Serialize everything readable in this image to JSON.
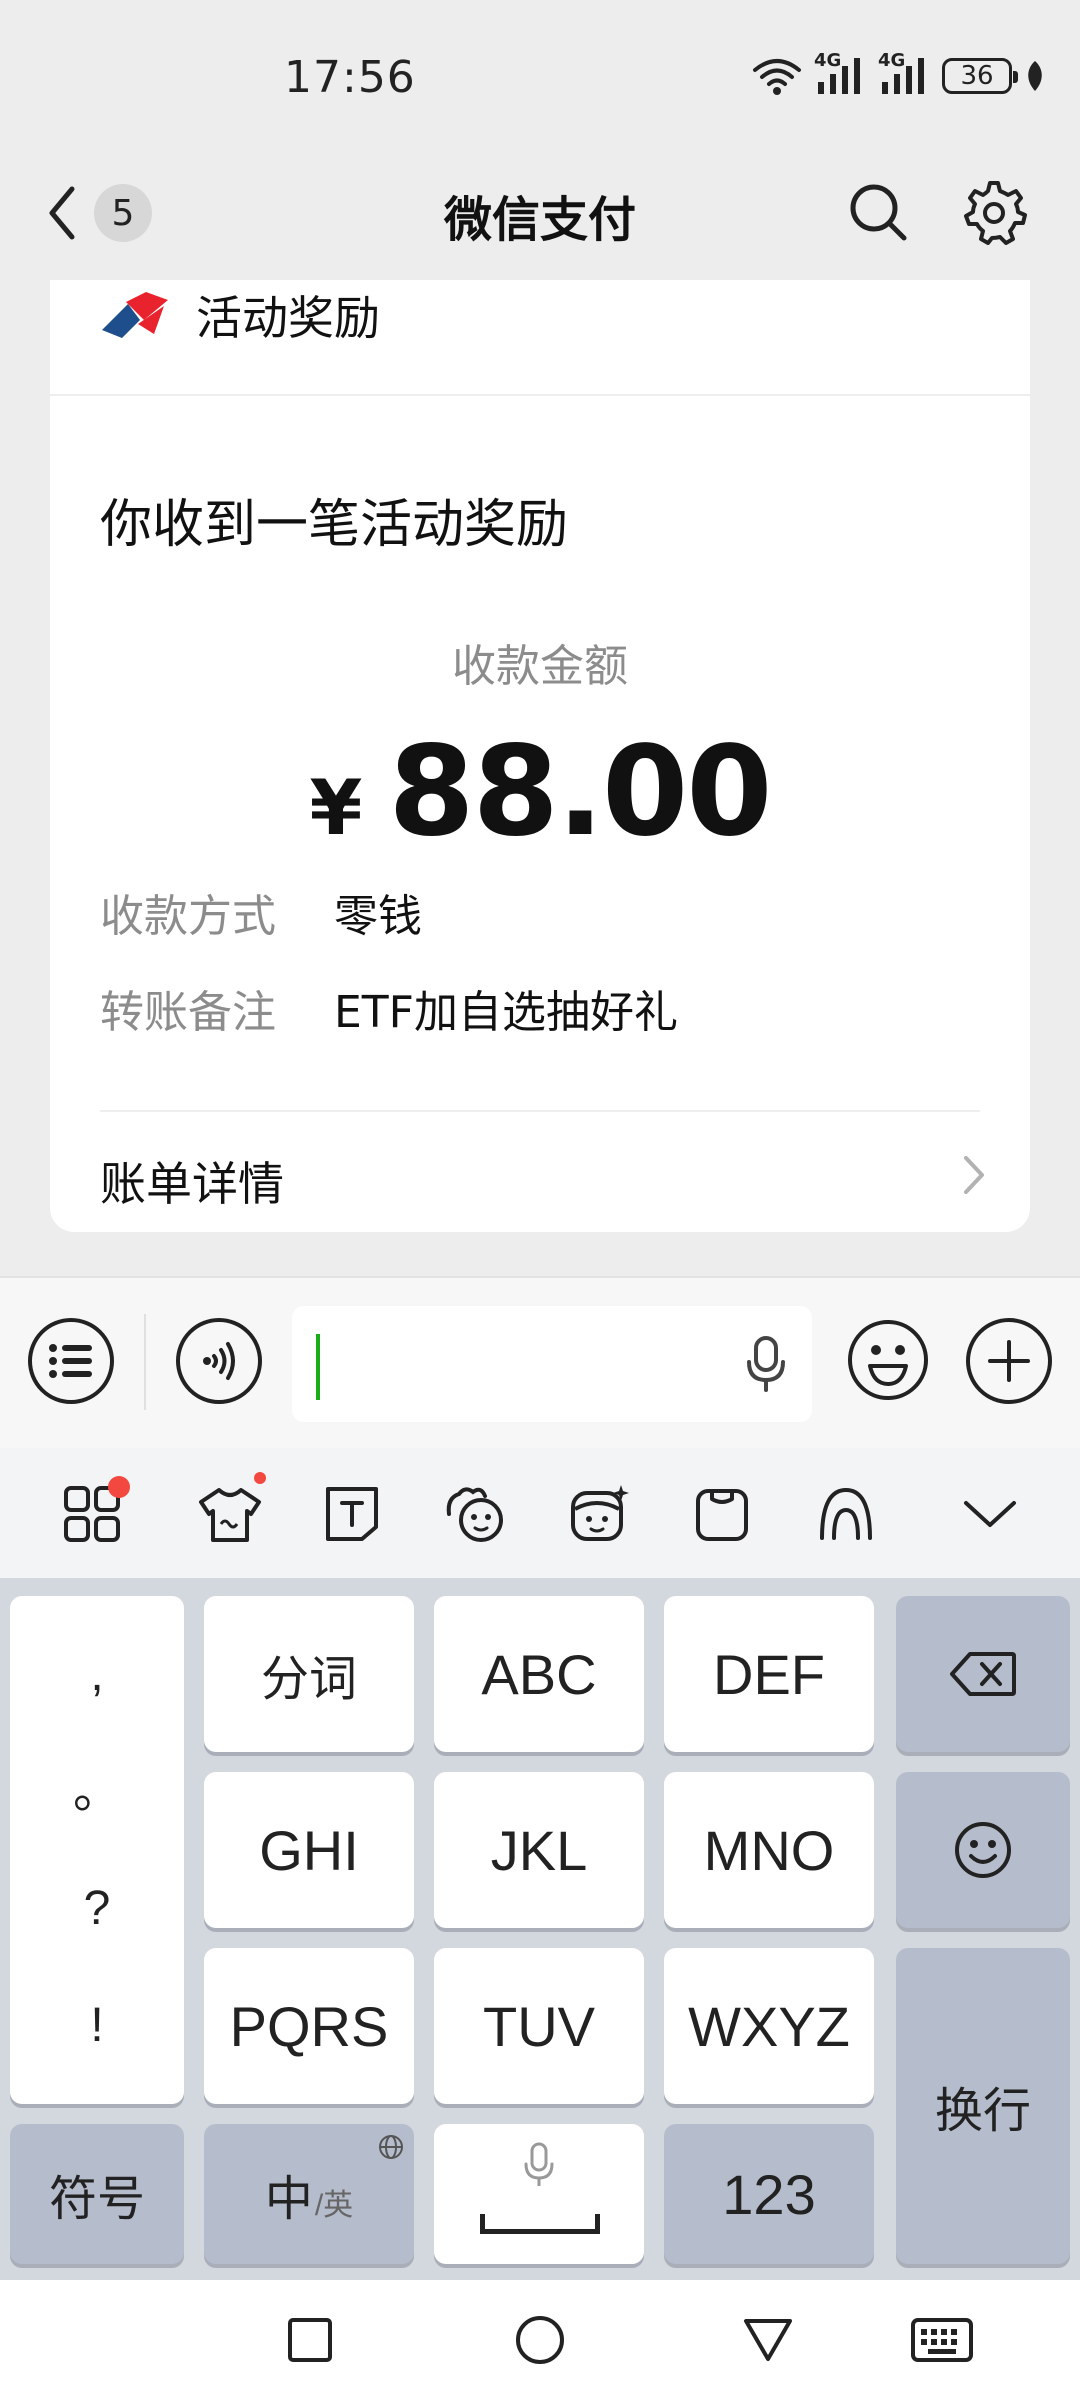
{
  "status_bar": {
    "time": "17:56",
    "network_1": "4G",
    "network_2": "4G",
    "battery": "36"
  },
  "header": {
    "unread_count": "5",
    "title": "微信支付"
  },
  "message": {
    "brand_name": "活动奖励",
    "title": "你收到一笔活动奖励",
    "amount_label": "收款金额",
    "currency": "¥",
    "amount": "88.00",
    "details": [
      {
        "label": "收款方式",
        "value": "零钱"
      },
      {
        "label": "转账备注",
        "value": "ETF加自选抽好礼"
      }
    ],
    "bill_label": "账单详情",
    "brand_colors": {
      "blue": "#1f4e8c",
      "red": "#e8232e"
    }
  },
  "input_bar": {
    "text": "",
    "accent": "#1aad19"
  },
  "keyboard": {
    "punctuation": [
      ",",
      "。",
      "?",
      "!"
    ],
    "row1": [
      "分词",
      "ABC",
      "DEF"
    ],
    "row2": [
      "GHI",
      "JKL",
      "MNO"
    ],
    "row3": [
      "PQRS",
      "TUV",
      "WXYZ"
    ],
    "symbols": "符号",
    "zh": "中",
    "en": "/英",
    "numbers": "123",
    "enter": "换行"
  }
}
